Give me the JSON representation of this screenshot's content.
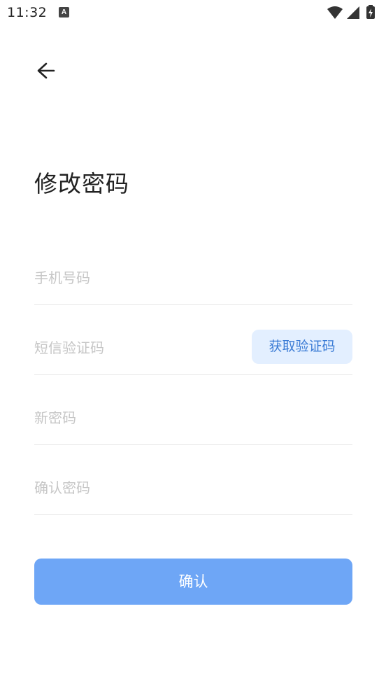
{
  "status_bar": {
    "time": "11:32",
    "notification_icon_letter": "A",
    "icons": [
      "wifi-icon",
      "signal-icon",
      "battery-charging-icon"
    ]
  },
  "header": {
    "back_icon": "arrow-left-icon"
  },
  "title": "修改密码",
  "form": {
    "phone_placeholder": "手机号码",
    "code_placeholder": "短信验证码",
    "get_code_label": "获取验证码",
    "new_password_placeholder": "新密码",
    "confirm_password_placeholder": "确认密码"
  },
  "confirm_label": "确认",
  "colors": {
    "primary_button": "#6ea6f6",
    "code_button_bg": "#e3efff",
    "code_button_text": "#3a7bd5",
    "placeholder": "#c6c6c6",
    "divider": "#e6e6e6"
  }
}
